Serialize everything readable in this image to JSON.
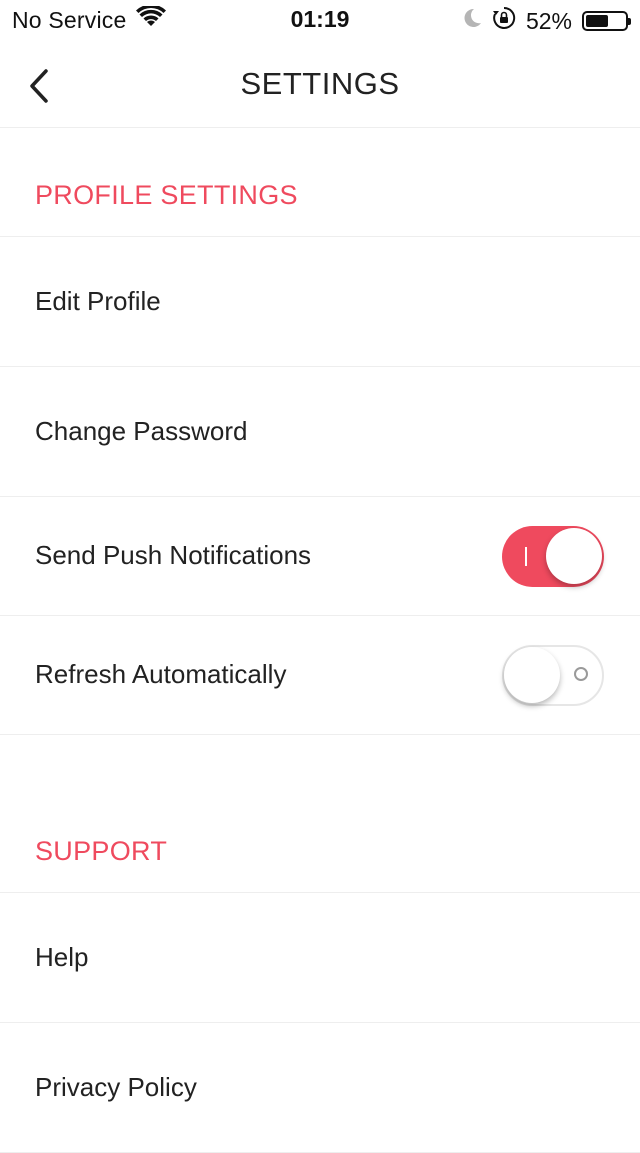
{
  "status_bar": {
    "carrier": "No Service",
    "time": "01:19",
    "battery_percent": "52%",
    "battery_level": 0.52,
    "icons": [
      "wifi-icon",
      "moon-icon",
      "rotation-lock-icon",
      "battery-icon"
    ]
  },
  "nav": {
    "title": "SETTINGS",
    "back_icon": "chevron-left-icon"
  },
  "sections": {
    "profile": {
      "header": "PROFILE SETTINGS",
      "items": [
        {
          "label": "Edit Profile"
        },
        {
          "label": "Change Password"
        },
        {
          "label": "Send Push Notifications",
          "toggle": true
        },
        {
          "label": "Refresh Automatically",
          "toggle": false
        }
      ]
    },
    "support": {
      "header": "SUPPORT",
      "items": [
        {
          "label": "Help"
        },
        {
          "label": "Privacy Policy"
        }
      ]
    }
  },
  "colors": {
    "accent": "#ef4a5e",
    "text": "#222222",
    "divider": "#eeeeee"
  }
}
